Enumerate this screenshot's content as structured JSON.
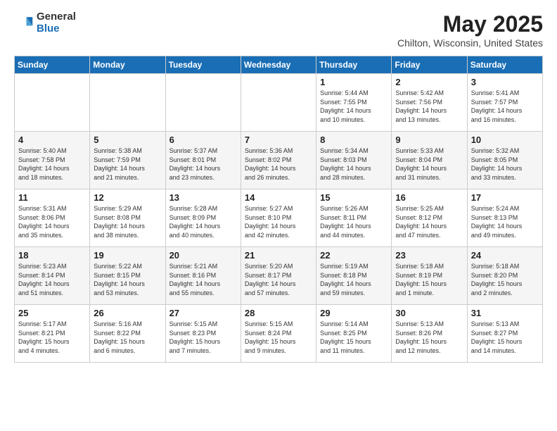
{
  "logo": {
    "general": "General",
    "blue": "Blue"
  },
  "title": {
    "month": "May 2025",
    "location": "Chilton, Wisconsin, United States"
  },
  "days_of_week": [
    "Sunday",
    "Monday",
    "Tuesday",
    "Wednesday",
    "Thursday",
    "Friday",
    "Saturday"
  ],
  "weeks": [
    [
      {
        "day": "",
        "info": ""
      },
      {
        "day": "",
        "info": ""
      },
      {
        "day": "",
        "info": ""
      },
      {
        "day": "",
        "info": ""
      },
      {
        "day": "1",
        "info": "Sunrise: 5:44 AM\nSunset: 7:55 PM\nDaylight: 14 hours\nand 10 minutes."
      },
      {
        "day": "2",
        "info": "Sunrise: 5:42 AM\nSunset: 7:56 PM\nDaylight: 14 hours\nand 13 minutes."
      },
      {
        "day": "3",
        "info": "Sunrise: 5:41 AM\nSunset: 7:57 PM\nDaylight: 14 hours\nand 16 minutes."
      }
    ],
    [
      {
        "day": "4",
        "info": "Sunrise: 5:40 AM\nSunset: 7:58 PM\nDaylight: 14 hours\nand 18 minutes."
      },
      {
        "day": "5",
        "info": "Sunrise: 5:38 AM\nSunset: 7:59 PM\nDaylight: 14 hours\nand 21 minutes."
      },
      {
        "day": "6",
        "info": "Sunrise: 5:37 AM\nSunset: 8:01 PM\nDaylight: 14 hours\nand 23 minutes."
      },
      {
        "day": "7",
        "info": "Sunrise: 5:36 AM\nSunset: 8:02 PM\nDaylight: 14 hours\nand 26 minutes."
      },
      {
        "day": "8",
        "info": "Sunrise: 5:34 AM\nSunset: 8:03 PM\nDaylight: 14 hours\nand 28 minutes."
      },
      {
        "day": "9",
        "info": "Sunrise: 5:33 AM\nSunset: 8:04 PM\nDaylight: 14 hours\nand 31 minutes."
      },
      {
        "day": "10",
        "info": "Sunrise: 5:32 AM\nSunset: 8:05 PM\nDaylight: 14 hours\nand 33 minutes."
      }
    ],
    [
      {
        "day": "11",
        "info": "Sunrise: 5:31 AM\nSunset: 8:06 PM\nDaylight: 14 hours\nand 35 minutes."
      },
      {
        "day": "12",
        "info": "Sunrise: 5:29 AM\nSunset: 8:08 PM\nDaylight: 14 hours\nand 38 minutes."
      },
      {
        "day": "13",
        "info": "Sunrise: 5:28 AM\nSunset: 8:09 PM\nDaylight: 14 hours\nand 40 minutes."
      },
      {
        "day": "14",
        "info": "Sunrise: 5:27 AM\nSunset: 8:10 PM\nDaylight: 14 hours\nand 42 minutes."
      },
      {
        "day": "15",
        "info": "Sunrise: 5:26 AM\nSunset: 8:11 PM\nDaylight: 14 hours\nand 44 minutes."
      },
      {
        "day": "16",
        "info": "Sunrise: 5:25 AM\nSunset: 8:12 PM\nDaylight: 14 hours\nand 47 minutes."
      },
      {
        "day": "17",
        "info": "Sunrise: 5:24 AM\nSunset: 8:13 PM\nDaylight: 14 hours\nand 49 minutes."
      }
    ],
    [
      {
        "day": "18",
        "info": "Sunrise: 5:23 AM\nSunset: 8:14 PM\nDaylight: 14 hours\nand 51 minutes."
      },
      {
        "day": "19",
        "info": "Sunrise: 5:22 AM\nSunset: 8:15 PM\nDaylight: 14 hours\nand 53 minutes."
      },
      {
        "day": "20",
        "info": "Sunrise: 5:21 AM\nSunset: 8:16 PM\nDaylight: 14 hours\nand 55 minutes."
      },
      {
        "day": "21",
        "info": "Sunrise: 5:20 AM\nSunset: 8:17 PM\nDaylight: 14 hours\nand 57 minutes."
      },
      {
        "day": "22",
        "info": "Sunrise: 5:19 AM\nSunset: 8:18 PM\nDaylight: 14 hours\nand 59 minutes."
      },
      {
        "day": "23",
        "info": "Sunrise: 5:18 AM\nSunset: 8:19 PM\nDaylight: 15 hours\nand 1 minute."
      },
      {
        "day": "24",
        "info": "Sunrise: 5:18 AM\nSunset: 8:20 PM\nDaylight: 15 hours\nand 2 minutes."
      }
    ],
    [
      {
        "day": "25",
        "info": "Sunrise: 5:17 AM\nSunset: 8:21 PM\nDaylight: 15 hours\nand 4 minutes."
      },
      {
        "day": "26",
        "info": "Sunrise: 5:16 AM\nSunset: 8:22 PM\nDaylight: 15 hours\nand 6 minutes."
      },
      {
        "day": "27",
        "info": "Sunrise: 5:15 AM\nSunset: 8:23 PM\nDaylight: 15 hours\nand 7 minutes."
      },
      {
        "day": "28",
        "info": "Sunrise: 5:15 AM\nSunset: 8:24 PM\nDaylight: 15 hours\nand 9 minutes."
      },
      {
        "day": "29",
        "info": "Sunrise: 5:14 AM\nSunset: 8:25 PM\nDaylight: 15 hours\nand 11 minutes."
      },
      {
        "day": "30",
        "info": "Sunrise: 5:13 AM\nSunset: 8:26 PM\nDaylight: 15 hours\nand 12 minutes."
      },
      {
        "day": "31",
        "info": "Sunrise: 5:13 AM\nSunset: 8:27 PM\nDaylight: 15 hours\nand 14 minutes."
      }
    ]
  ]
}
